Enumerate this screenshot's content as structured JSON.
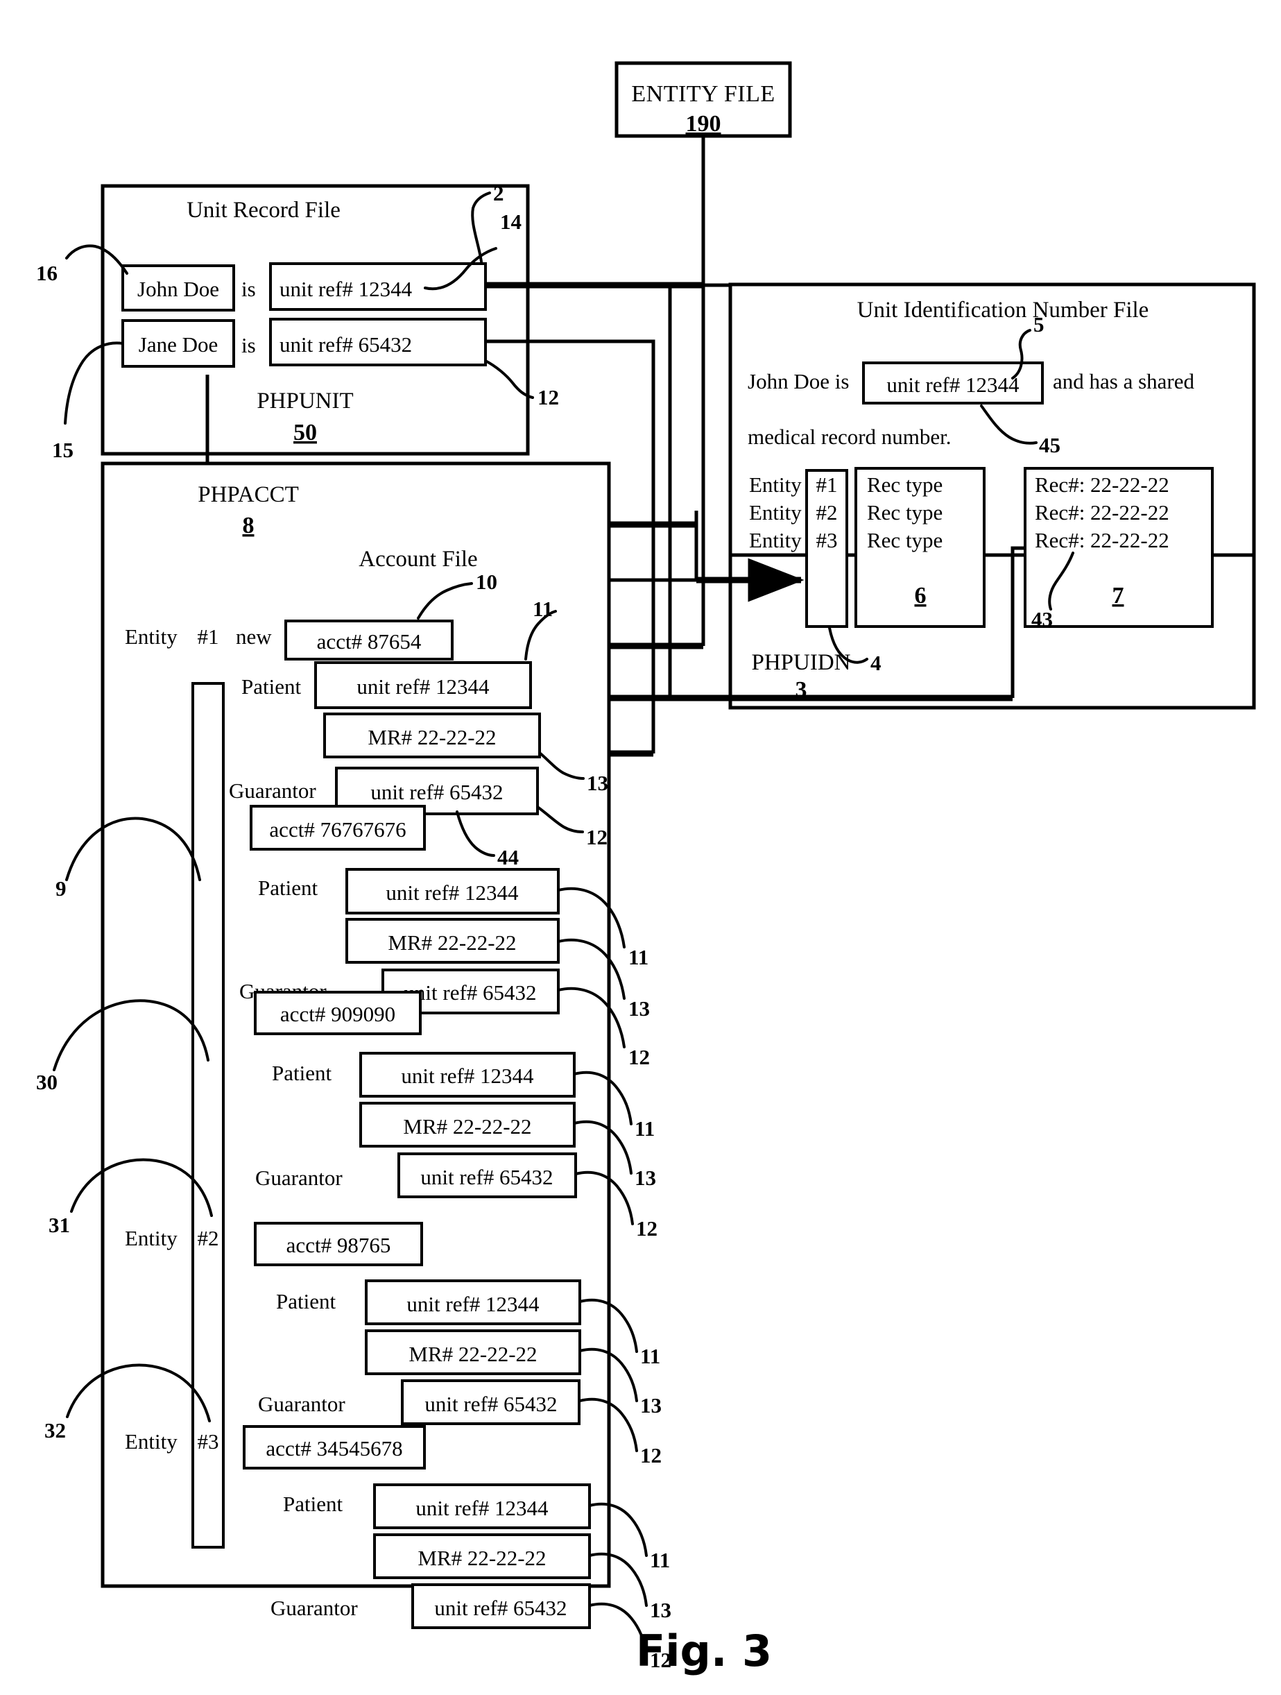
{
  "figure": {
    "caption": "Fig. 3"
  },
  "entity_file": {
    "title": "ENTITY FILE",
    "number": "190"
  },
  "unit_record_file": {
    "title": "Unit Record File",
    "footer_name": "PHPUNIT",
    "footer_number": "50",
    "rows": [
      {
        "name": "John Doe",
        "verb": "is",
        "ref": "unit ref# 12344"
      },
      {
        "name": "Jane Doe",
        "verb": "is",
        "ref": "unit ref# 65432"
      }
    ],
    "callouts": {
      "c2": "2",
      "c14": "14",
      "c12": "12",
      "c16": "16",
      "c15": "15"
    }
  },
  "uidn_file": {
    "title": "Unit Identification Number File",
    "sentence_prefix": "John Doe is",
    "sentence_ref": "unit ref# 12344",
    "sentence_mid": "and has a shared",
    "sentence_suffix": "medical record number.",
    "footer_name": "PHPUIDN",
    "footer_number": "3",
    "entity_rows": [
      {
        "label": "Entity",
        "num": "#1",
        "rectype": "Rec type",
        "recnum": "Rec#: 22-22-22"
      },
      {
        "label": "Entity",
        "num": "#2",
        "rectype": "Rec type",
        "recnum": "Rec#: 22-22-22"
      },
      {
        "label": "Entity",
        "num": "#3",
        "rectype": "Rec type",
        "recnum": "Rec#: 22-22-22"
      }
    ],
    "callouts": {
      "c5": "5",
      "c45": "45",
      "c4": "4",
      "c6": "6",
      "c7": "7",
      "c43": "43"
    }
  },
  "account_file": {
    "header_name": "PHPACCT",
    "header_number": "8",
    "title": "Account File",
    "entity_label": "Entity",
    "new_label": "new",
    "patient_label": "Patient",
    "guarantor_label": "Guarantor",
    "groups": [
      {
        "entity_num": "#1",
        "new_flag": "new",
        "acct": "acct# 87654",
        "patient_ref": "unit ref# 12344",
        "mr": "MR# 22-22-22",
        "guarantor_ref": "unit ref# 65432"
      },
      {
        "entity_num": "",
        "new_flag": "",
        "acct": "acct# 76767676",
        "patient_ref": "unit ref# 12344",
        "mr": "MR# 22-22-22",
        "guarantor_ref": "unit ref# 65432"
      },
      {
        "entity_num": "",
        "new_flag": "",
        "acct": "acct# 909090",
        "patient_ref": "unit ref# 12344",
        "mr": "MR# 22-22-22",
        "guarantor_ref": "unit ref# 65432"
      },
      {
        "entity_num": "#2",
        "new_flag": "",
        "acct": "acct# 98765",
        "patient_ref": "unit ref# 12344",
        "mr": "MR# 22-22-22",
        "guarantor_ref": "unit ref# 65432"
      },
      {
        "entity_num": "#3",
        "new_flag": "",
        "acct": "acct# 34545678",
        "patient_ref": "unit ref# 12344",
        "mr": "MR# 22-22-22",
        "guarantor_ref": "unit ref# 65432"
      }
    ],
    "callouts": {
      "c10": "10",
      "c11": "11",
      "c13": "13",
      "c12": "12",
      "c44": "44",
      "c9": "9",
      "c30": "30",
      "c31": "31",
      "c32": "32"
    }
  }
}
